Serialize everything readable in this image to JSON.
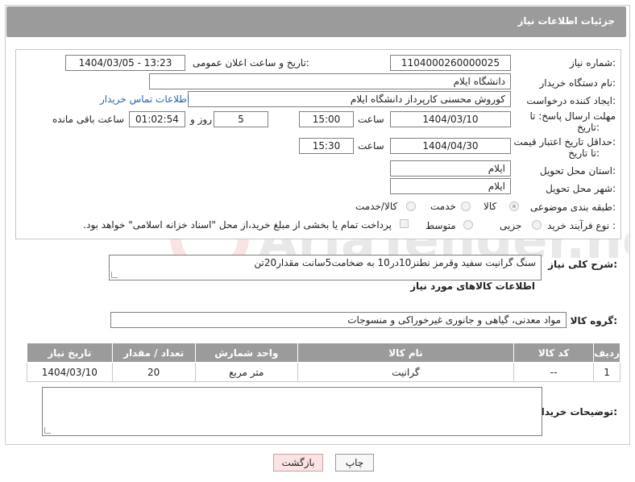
{
  "header": {
    "title": "جزئیات اطلاعات نیاز"
  },
  "form": {
    "need_number_label": "شماره نیاز:",
    "need_number": "1104000260000025",
    "announce_label": "تاریخ و ساعت اعلان عمومی:",
    "announce_value": "1404/03/05 - 13:23",
    "buyer_org_label": "نام دستگاه خریدار:",
    "buyer_org": "دانشگاه ایلام",
    "creator_label": "ایجاد کننده درخواست:",
    "creator": "کوروش محسنی کارپرداز دانشگاه ایلام",
    "contact_link": "اطلاعات تماس خریدار",
    "reply_deadline_label_1": "مهلت ارسال پاسخ: تا",
    "reply_deadline_label_2": "تاریخ:",
    "reply_date": "1404/03/10",
    "time_label": "ساعت",
    "reply_time": "15:00",
    "days_value": "5",
    "days_label": "روز و",
    "remaining_time": "01:02:54",
    "remaining_label": "ساعت باقی مانده",
    "price_deadline_label_1": "حداقل تاریخ اعتبار قیمت:",
    "price_deadline_label_2": "تا تاریخ:",
    "price_date": "1404/04/30",
    "price_time": "15:30",
    "province_label": "استان محل تحویل:",
    "province": "ایلام",
    "city_label": "شهر محل تحویل:",
    "city": "ایلام",
    "category_label": "طبقه بندی موضوعی:",
    "category_options": [
      "کالا",
      "خدمت",
      "کالا/خدمت"
    ],
    "category_selected": "کالا",
    "process_label": "نوع فرآیند خرید :",
    "process_options": [
      "جزیی",
      "متوسط"
    ],
    "payment_note": "پرداخت تمام یا بخشی از مبلغ خرید،از محل \"اسناد خزانه اسلامی\" خواهد بود."
  },
  "summary": {
    "label": "شرح کلی نیاز:",
    "text": "سنگ گرانیت سفید وقرمز نطنز10در10 به ضخامت5سانت مقدار20تن"
  },
  "goods": {
    "section_title": "اطلاعات کالاهای مورد نیاز",
    "group_label": "گروه کالا:",
    "group_value": "مواد معدنی، گیاهی و جانوری غیرخوراکی و منسوجات",
    "columns": [
      "ردیف",
      "کد کالا",
      "نام کالا",
      "واحد شمارش",
      "تعداد / مقدار",
      "تاریخ نیاز"
    ],
    "rows": [
      {
        "row": "1",
        "code": "--",
        "name": "گرانیت",
        "unit": "متر مربع",
        "qty": "20",
        "date": "1404/03/10"
      }
    ]
  },
  "buyer_notes": {
    "label": "توضیحات خریدار:",
    "text": ""
  },
  "buttons": {
    "print": "چاپ",
    "back": "بازگشت"
  },
  "watermark": {
    "text": "AriaTender.net"
  },
  "colors": {
    "header_bg": "#9b9b9b",
    "link": "#2a63b5",
    "back_button_bg": "#fbe3e3"
  }
}
